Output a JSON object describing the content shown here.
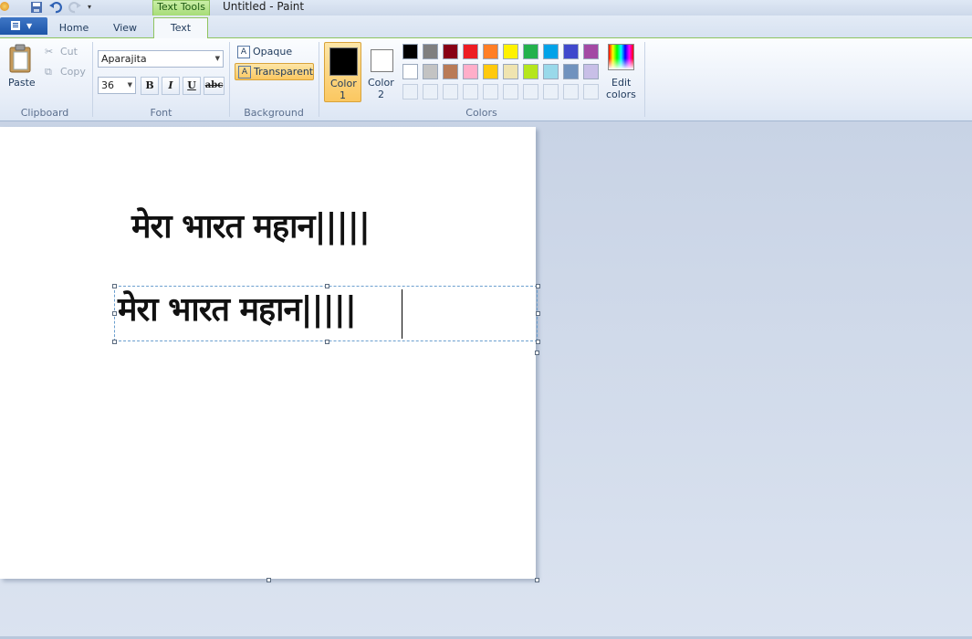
{
  "window": {
    "title": "Untitled - Paint",
    "context_tab": "Text Tools"
  },
  "tabs": [
    "Home",
    "View",
    "Text"
  ],
  "active_tab": "Text",
  "clipboard": {
    "paste": "Paste",
    "cut": "Cut",
    "copy": "Copy",
    "group": "Clipboard"
  },
  "font": {
    "family": "Aparajita",
    "size": "36",
    "bold": "B",
    "italic": "I",
    "underline": "U",
    "strike": "abc",
    "group": "Font"
  },
  "background": {
    "opaque": "Opaque",
    "transparent": "Transparent",
    "selected": "Transparent",
    "group": "Background"
  },
  "colors": {
    "color1_line1": "Color",
    "color1_line2": "1",
    "color2_line1": "Color",
    "color2_line2": "2",
    "color1": "#000000",
    "color2": "#ffffff",
    "palette_row1": [
      "#000000",
      "#7f7f7f",
      "#880015",
      "#ed1c24",
      "#ff7f27",
      "#fff200",
      "#22b14c",
      "#00a2e8",
      "#3f48cc",
      "#a349a4"
    ],
    "palette_row2": [
      "#ffffff",
      "#c3c3c3",
      "#b97a57",
      "#ffaec9",
      "#ffc90e",
      "#efe4b0",
      "#b5e61d",
      "#99d9ea",
      "#7092be",
      "#c8bfe7"
    ],
    "edit_line1": "Edit",
    "edit_line2": "colors",
    "group": "Colors"
  },
  "canvas": {
    "text1": "मेरा भारत महान|||||",
    "text2": "मेरा भारत महान|||||"
  }
}
